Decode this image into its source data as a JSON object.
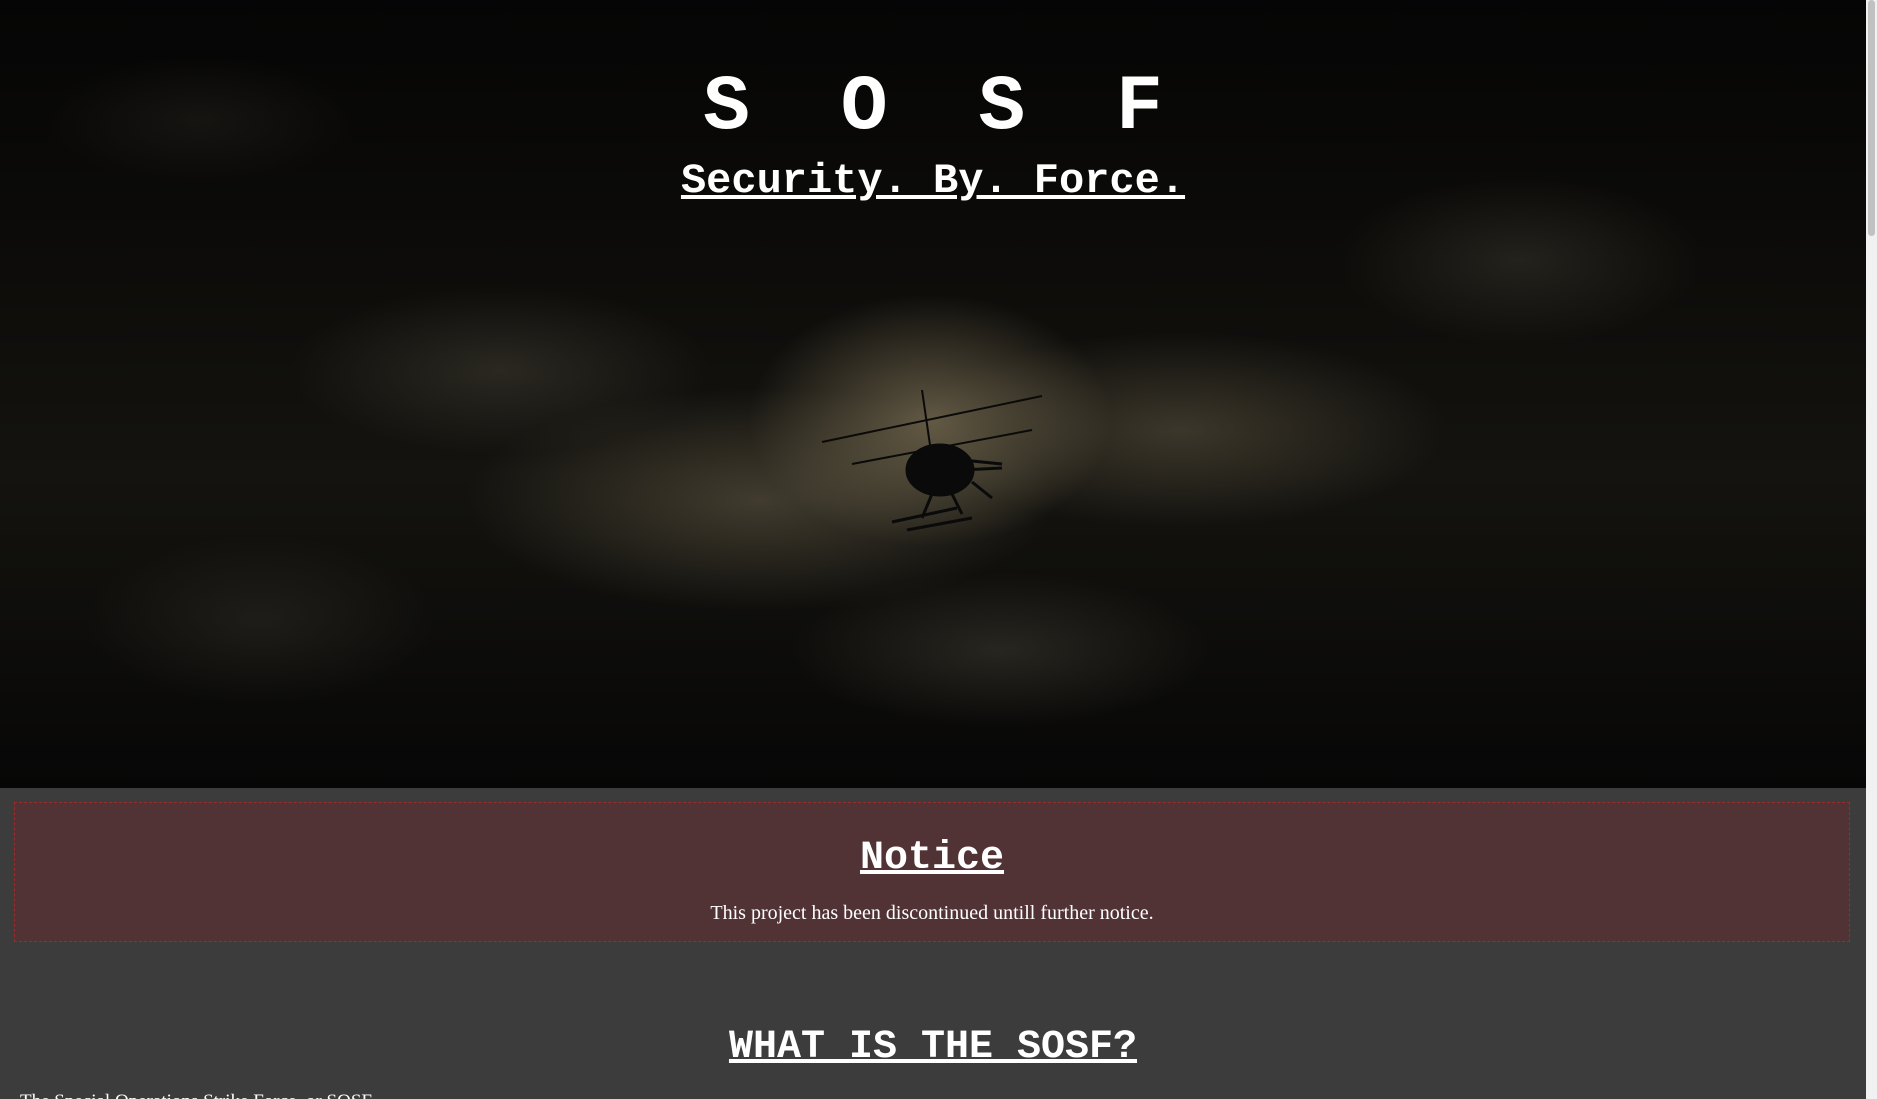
{
  "hero": {
    "title": "S O S F",
    "subtitle": "Security. By. Force."
  },
  "notice": {
    "title": "Notice",
    "text": "This project has been discontinued untill further notice."
  },
  "about": {
    "title": "WHAT IS THE SOSF?",
    "text": "The Special Operations Strike Force, or SOSF, ..."
  },
  "colors": {
    "page_background": "#3c3c3c",
    "notice_background": "#513336",
    "notice_border": "#9c2b2b",
    "text": "#ffffff"
  },
  "icons": {
    "hero_image": "helicopter-silhouette"
  }
}
